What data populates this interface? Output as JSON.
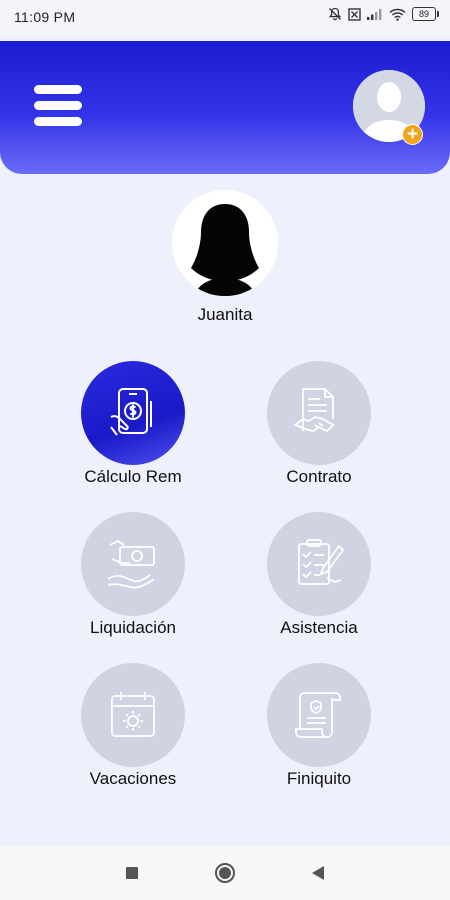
{
  "status": {
    "time": "11:09 PM",
    "battery": "89"
  },
  "header": {
    "menu_icon": "hamburger-menu-icon",
    "avatar_icon": "user-placeholder-icon",
    "add_icon": "plus-badge-icon",
    "add_symbol": "+"
  },
  "profile": {
    "name": "Juanita"
  },
  "tiles": [
    {
      "label": "Cálculo Rem",
      "icon": "phone-money-icon",
      "active": true
    },
    {
      "label": "Contrato",
      "icon": "contract-handshake-icon",
      "active": false
    },
    {
      "label": "Liquidación",
      "icon": "cash-hand-icon",
      "active": false
    },
    {
      "label": "Asistencia",
      "icon": "checklist-pen-icon",
      "active": false
    },
    {
      "label": "Vacaciones",
      "icon": "calendar-sun-icon",
      "active": false
    },
    {
      "label": "Finiquito",
      "icon": "scroll-document-icon",
      "active": false
    }
  ],
  "navbar": {
    "recents": "square-icon",
    "home": "circle-icon",
    "back": "triangle-back-icon"
  },
  "colors": {
    "header_top": "#1b1bd0",
    "header_bottom": "#6b6bf7",
    "tile_inactive": "#cfd3e2",
    "badge": "#f2a51a",
    "background": "#eef1fb"
  }
}
